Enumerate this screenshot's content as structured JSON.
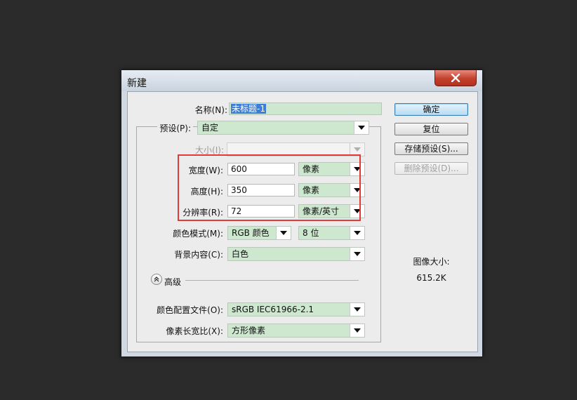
{
  "window": {
    "title": "新建"
  },
  "form": {
    "name_label": "名称(N):",
    "name_value": "未标题-1",
    "preset_label": "预设(P):",
    "preset_value": "自定",
    "size_label": "大小(I):",
    "size_value": "",
    "width_label": "宽度(W):",
    "width_value": "600",
    "width_unit": "像素",
    "height_label": "高度(H):",
    "height_value": "350",
    "height_unit": "像素",
    "resolution_label": "分辨率(R):",
    "resolution_value": "72",
    "resolution_unit": "像素/英寸",
    "color_mode_label": "颜色模式(M):",
    "color_mode_value": "RGB 颜色",
    "bit_depth_value": "8 位",
    "background_label": "背景内容(C):",
    "background_value": "白色",
    "advanced_label": "高级",
    "color_profile_label": "颜色配置文件(O):",
    "color_profile_value": "sRGB IEC61966-2.1",
    "pixel_aspect_label": "像素长宽比(X):",
    "pixel_aspect_value": "方形像素"
  },
  "buttons": {
    "ok": "确定",
    "reset": "复位",
    "save_preset": "存储预设(S)...",
    "delete_preset": "删除预设(D)..."
  },
  "image_size": {
    "label": "图像大小:",
    "value": "615.2K"
  },
  "colors": {
    "field_green": "#cde8cf",
    "highlight_red": "#e03a3a",
    "close_red": "#c2402c"
  }
}
